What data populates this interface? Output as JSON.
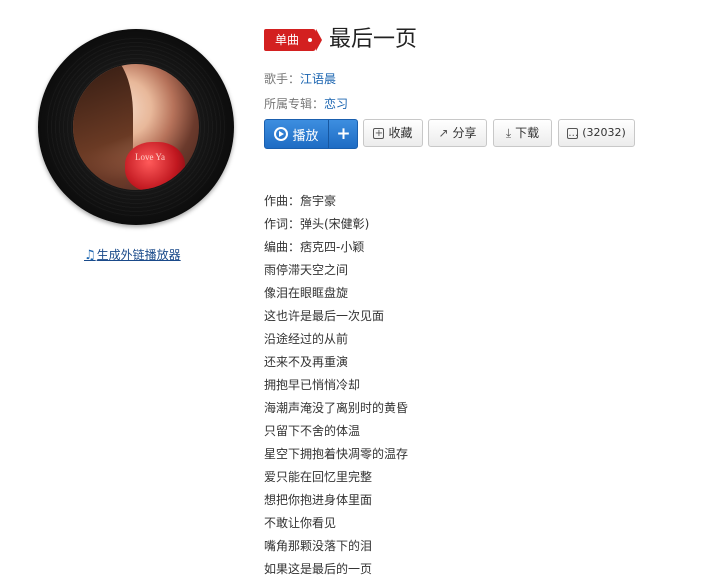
{
  "song": {
    "badge": "单曲",
    "title": "最后一页",
    "singer_label": "歌手：",
    "singer": "江语晨",
    "album_label": "所属专辑：",
    "album": "恋习"
  },
  "cover": {
    "caption": "Love Ya"
  },
  "generate_link": {
    "icon": "music-note-icon",
    "label": "生成外链播放器"
  },
  "actions": {
    "play_label": "播放",
    "add_label": "+",
    "collect_label": "收藏",
    "share_label": "分享",
    "download_label": "下载",
    "comment_count": "(32032)"
  },
  "lyrics": [
    "作曲：詹宇豪",
    "作词：弹头(宋健彰)",
    "编曲：痞克四-小颖",
    "雨停滞天空之间",
    "像泪在眼眶盘旋",
    "这也许是最后一次见面",
    "沿途经过的从前",
    "还来不及再重演",
    "拥抱早已悄悄冷却",
    "海潮声淹没了离别时的黄昏",
    "只留下不舍的体温",
    "星空下拥抱着快凋零的温存",
    "爱只能在回忆里完整",
    "想把你抱进身体里面",
    "不敢让你看见",
    "嘴角那颗没落下的泪",
    "如果这是最后的一页"
  ],
  "colors": {
    "accent_red": "#d32020",
    "play_blue": "#1e6cc4",
    "link_blue": "#1a64b0"
  }
}
